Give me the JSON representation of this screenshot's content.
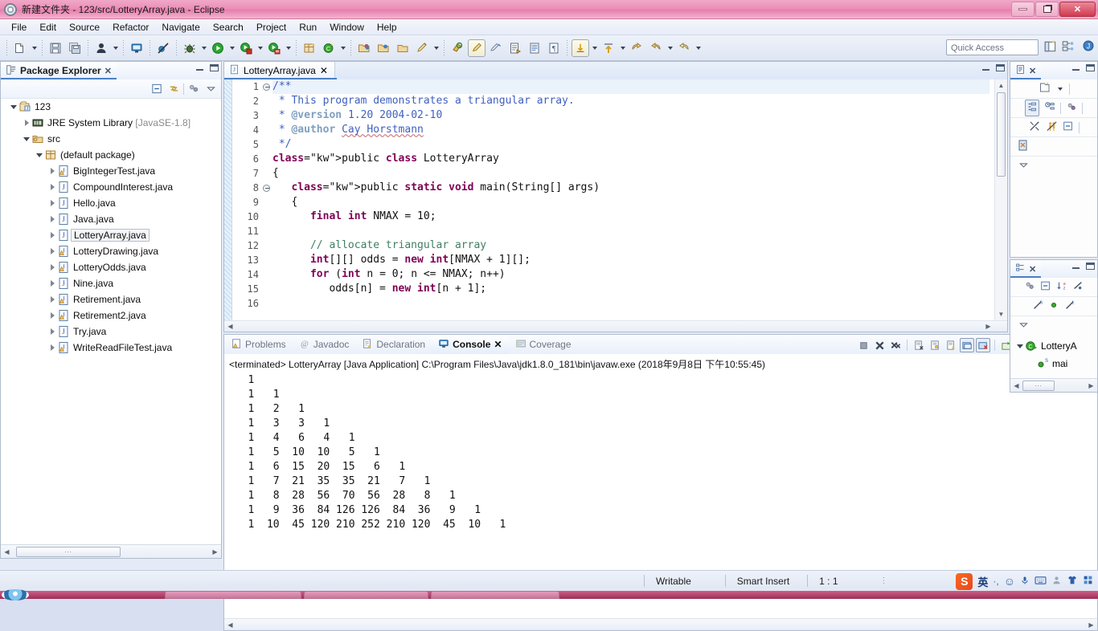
{
  "window": {
    "title": "新建文件夹 - 123/src/LotteryArray.java - Eclipse",
    "app_icon": "eclipse-icon",
    "minimize_label": "Minimize",
    "restore_label": "Restore",
    "close_label": "Close"
  },
  "menu": {
    "items": [
      {
        "label": "File"
      },
      {
        "label": "Edit"
      },
      {
        "label": "Source"
      },
      {
        "label": "Refactor"
      },
      {
        "label": "Navigate"
      },
      {
        "label": "Search"
      },
      {
        "label": "Project"
      },
      {
        "label": "Run"
      },
      {
        "label": "Window"
      },
      {
        "label": "Help"
      }
    ]
  },
  "toolbar": {
    "quick_access_placeholder": "Quick Access",
    "buttons": [
      {
        "name": "new-wizard-icon"
      },
      {
        "name": "save-icon"
      },
      {
        "name": "save-all-icon"
      },
      {
        "name": "person-icon"
      },
      {
        "name": "console-view-icon"
      },
      {
        "name": "skip-breakpoints-icon"
      },
      {
        "name": "debug-icon"
      },
      {
        "name": "run-icon"
      },
      {
        "name": "external-tools-icon"
      },
      {
        "name": "coverage-icon"
      },
      {
        "name": "new-java-package-icon"
      },
      {
        "name": "new-java-class-icon"
      },
      {
        "name": "open-type-icon"
      },
      {
        "name": "open-task-icon"
      },
      {
        "name": "search-icon"
      },
      {
        "name": "pin-editor-icon"
      },
      {
        "name": "toggle-mark-occurrences-icon"
      },
      {
        "name": "next-annotation-icon"
      },
      {
        "name": "previous-annotation-icon"
      },
      {
        "name": "last-edit-location-icon"
      },
      {
        "name": "back-icon"
      },
      {
        "name": "forward-icon"
      }
    ],
    "right_buttons": [
      {
        "name": "open-perspective-icon"
      },
      {
        "name": "java-browsing-perspective-icon"
      },
      {
        "name": "java-perspective-icon"
      }
    ]
  },
  "package_explorer": {
    "title": "Package Explorer",
    "close_label": "✕",
    "toolbar": [
      {
        "name": "collapse-all-icon"
      },
      {
        "name": "link-with-editor-icon"
      },
      {
        "name": "view-menu-filter-icon"
      },
      {
        "name": "view-menu-icon"
      }
    ],
    "tree": [
      {
        "label": "123",
        "icon": "java-project-icon",
        "indent": 0,
        "state": "open",
        "selected": false,
        "suffix": ""
      },
      {
        "label": "JRE System Library",
        "icon": "library-icon",
        "indent": 1,
        "state": "closed",
        "selected": false,
        "suffix": "[JavaSE-1.8]"
      },
      {
        "label": "src",
        "icon": "source-folder-icon",
        "indent": 1,
        "state": "open",
        "selected": false,
        "suffix": ""
      },
      {
        "label": "(default package)",
        "icon": "package-icon",
        "indent": 2,
        "state": "open",
        "selected": false,
        "suffix": ""
      },
      {
        "label": "BigIntegerTest.java",
        "icon": "java-file-warning-icon",
        "indent": 3,
        "state": "closed",
        "selected": false,
        "suffix": ""
      },
      {
        "label": "CompoundInterest.java",
        "icon": "java-file-icon",
        "indent": 3,
        "state": "closed",
        "selected": false,
        "suffix": ""
      },
      {
        "label": "Hello.java",
        "icon": "java-file-icon",
        "indent": 3,
        "state": "closed",
        "selected": false,
        "suffix": ""
      },
      {
        "label": "Java.java",
        "icon": "java-file-icon",
        "indent": 3,
        "state": "closed",
        "selected": false,
        "suffix": ""
      },
      {
        "label": "LotteryArray.java",
        "icon": "java-file-icon",
        "indent": 3,
        "state": "closed",
        "selected": true,
        "suffix": ""
      },
      {
        "label": "LotteryDrawing.java",
        "icon": "java-file-warning-icon",
        "indent": 3,
        "state": "closed",
        "selected": false,
        "suffix": ""
      },
      {
        "label": "LotteryOdds.java",
        "icon": "java-file-warning-icon",
        "indent": 3,
        "state": "closed",
        "selected": false,
        "suffix": ""
      },
      {
        "label": "Nine.java",
        "icon": "java-file-icon",
        "indent": 3,
        "state": "closed",
        "selected": false,
        "suffix": ""
      },
      {
        "label": "Retirement.java",
        "icon": "java-file-warning-icon",
        "indent": 3,
        "state": "closed",
        "selected": false,
        "suffix": ""
      },
      {
        "label": "Retirement2.java",
        "icon": "java-file-warning-icon",
        "indent": 3,
        "state": "closed",
        "selected": false,
        "suffix": ""
      },
      {
        "label": "Try.java",
        "icon": "java-file-icon",
        "indent": 3,
        "state": "closed",
        "selected": false,
        "suffix": ""
      },
      {
        "label": "WriteReadFileTest.java",
        "icon": "java-file-warning-icon",
        "indent": 3,
        "state": "closed",
        "selected": false,
        "suffix": ""
      }
    ]
  },
  "editor": {
    "tab_label": "LotteryArray.java",
    "tab_icon": "java-file-icon",
    "tab_close": "✕",
    "lines": [
      {
        "num": "1",
        "fold": true,
        "highlight": true,
        "text": "/**",
        "style": "jd"
      },
      {
        "num": "2",
        "fold": false,
        "highlight": false,
        "text": " * This program demonstrates a triangular array.",
        "style": "jd"
      },
      {
        "num": "3",
        "fold": false,
        "highlight": false,
        "text": " * @version 1.20 2004-02-10",
        "style": "jd-tag"
      },
      {
        "num": "4",
        "fold": false,
        "highlight": false,
        "text": " * @author Cay Horstmann",
        "style": "jd-author"
      },
      {
        "num": "5",
        "fold": false,
        "highlight": false,
        "text": " */",
        "style": "jd"
      },
      {
        "num": "6",
        "fold": false,
        "highlight": false,
        "text": "public class LotteryArray",
        "style": "code-class"
      },
      {
        "num": "7",
        "fold": false,
        "highlight": false,
        "text": "{",
        "style": "plain"
      },
      {
        "num": "8",
        "fold": true,
        "highlight": false,
        "text": "   public static void main(String[] args)",
        "style": "code-main"
      },
      {
        "num": "9",
        "fold": false,
        "highlight": false,
        "text": "   {",
        "style": "plain"
      },
      {
        "num": "10",
        "fold": false,
        "highlight": false,
        "text": "      final int NMAX = 10;",
        "style": "code-final"
      },
      {
        "num": "11",
        "fold": false,
        "highlight": false,
        "text": "",
        "style": "plain"
      },
      {
        "num": "12",
        "fold": false,
        "highlight": false,
        "text": "      // allocate triangular array",
        "style": "comment"
      },
      {
        "num": "13",
        "fold": false,
        "highlight": false,
        "text": "      int[][] odds = new int[NMAX + 1][];",
        "style": "code-alloc"
      },
      {
        "num": "14",
        "fold": false,
        "highlight": false,
        "text": "      for (int n = 0; n <= NMAX; n++)",
        "style": "code-for"
      },
      {
        "num": "15",
        "fold": false,
        "highlight": false,
        "text": "         odds[n] = new int[n + 1];",
        "style": "code-assign"
      },
      {
        "num": "16",
        "fold": false,
        "highlight": false,
        "text": "",
        "style": "plain"
      }
    ]
  },
  "console": {
    "tabs": [
      {
        "label": "Problems",
        "icon": "problems-icon",
        "active": false
      },
      {
        "label": "Javadoc",
        "icon": "javadoc-icon",
        "active": false
      },
      {
        "label": "Declaration",
        "icon": "declaration-icon",
        "active": false
      },
      {
        "label": "Console",
        "icon": "console-icon",
        "active": true
      },
      {
        "label": "Coverage",
        "icon": "coverage-icon",
        "active": false
      }
    ],
    "close_label": "✕",
    "toolbar": [
      {
        "name": "terminate-icon"
      },
      {
        "name": "remove-launch-icon"
      },
      {
        "name": "remove-all-terminated-icon"
      },
      {
        "name": "clear-console-icon"
      },
      {
        "name": "scroll-lock-icon"
      },
      {
        "name": "show-console-on-output-icon"
      },
      {
        "name": "pin-console-icon"
      },
      {
        "name": "display-selected-console-icon"
      },
      {
        "name": "open-console-icon"
      },
      {
        "name": "console-view-menu-icon"
      },
      {
        "name": "new-console-view-icon"
      },
      {
        "name": "minimize-icon"
      },
      {
        "name": "maximize-icon"
      }
    ],
    "header": "<terminated> LotteryArray [Java Application] C:\\Program Files\\Java\\jdk1.8.0_181\\bin\\javaw.exe (2018年9月8日 下午10:55:45)",
    "output_rows": [
      [
        "1"
      ],
      [
        "1",
        "1"
      ],
      [
        "1",
        "2",
        "1"
      ],
      [
        "1",
        "3",
        "3",
        "1"
      ],
      [
        "1",
        "4",
        "6",
        "4",
        "1"
      ],
      [
        "1",
        "5",
        "10",
        "10",
        "5",
        "1"
      ],
      [
        "1",
        "6",
        "15",
        "20",
        "15",
        "6",
        "1"
      ],
      [
        "1",
        "7",
        "21",
        "35",
        "35",
        "21",
        "7",
        "1"
      ],
      [
        "1",
        "8",
        "28",
        "56",
        "70",
        "56",
        "28",
        "8",
        "1"
      ],
      [
        "1",
        "9",
        "36",
        "84",
        "126",
        "126",
        "84",
        "36",
        "9",
        "1"
      ],
      [
        "1",
        "10",
        "45",
        "120",
        "210",
        "252",
        "210",
        "120",
        "45",
        "10",
        "1"
      ]
    ]
  },
  "right_panels": {
    "top": {
      "title_icon": "task-list-icon",
      "close_label": "✕",
      "toolbar": [
        {
          "name": "new-task-icon"
        },
        {
          "name": "categorized-presentation-icon"
        },
        {
          "name": "scheduled-presentation-icon"
        },
        {
          "name": "focus-on-workweek-icon"
        },
        {
          "name": "filter-completed-icon"
        },
        {
          "name": "synchronize-icon"
        },
        {
          "name": "collapse-all-icon"
        },
        {
          "name": "find-icon"
        },
        {
          "name": "view-menu-icon"
        }
      ]
    },
    "bottom": {
      "title_icon": "outline-icon",
      "close_label": "✕",
      "toolbar": [
        {
          "name": "focus-icon"
        },
        {
          "name": "collapse-all-icon"
        },
        {
          "name": "sort-icon"
        },
        {
          "name": "hide-fields-icon"
        },
        {
          "name": "hide-static-icon"
        },
        {
          "name": "hide-non-public-icon"
        },
        {
          "name": "hide-local-types-icon"
        },
        {
          "name": "view-menu-icon"
        }
      ],
      "tree": [
        {
          "label": "LotteryA",
          "icon": "class-icon",
          "indent": 0,
          "state": "open"
        },
        {
          "label": "mai",
          "icon": "method-static-icon",
          "indent": 1,
          "state": "leaf"
        }
      ]
    }
  },
  "status_bar": {
    "writable": "Writable",
    "insert_mode": "Smart Insert",
    "position": "1 : 1"
  },
  "ime": {
    "logo_text": "S",
    "language": "英",
    "items": [
      {
        "name": "punctuation-icon",
        "glyph": "·,"
      },
      {
        "name": "emoji-icon",
        "glyph": "☺"
      },
      {
        "name": "voice-input-icon",
        "glyph": "🎤"
      },
      {
        "name": "soft-keyboard-icon",
        "glyph": "⌨"
      },
      {
        "name": "user-icon",
        "glyph": "👤"
      },
      {
        "name": "skin-icon",
        "glyph": "👕"
      },
      {
        "name": "toolbox-icon",
        "glyph": "▦"
      }
    ]
  },
  "colors": {
    "title_pink": "#ec8fb8",
    "accent_blue": "#4a7fc1",
    "keyword": "#7f0055",
    "comment": "#3f7f5f",
    "javadoc": "#3f5fbf"
  }
}
